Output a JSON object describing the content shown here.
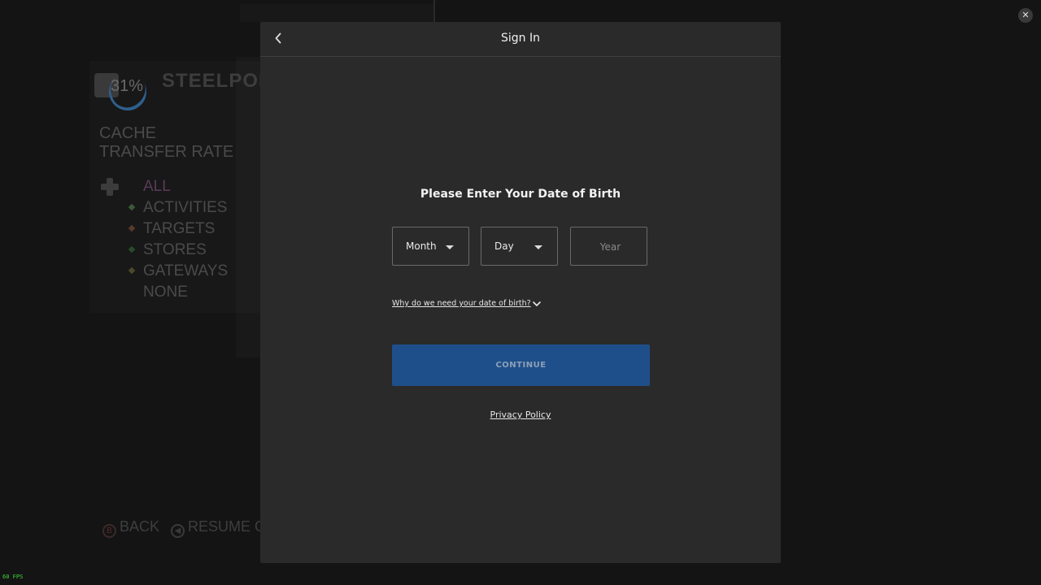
{
  "background_game": {
    "percent": "31%",
    "location_title": "STEELPORT",
    "category_line1": "CACHE",
    "category_line2": "TRANSFER RATE",
    "filters": [
      {
        "label": "ALL",
        "color": ""
      },
      {
        "label": "ACTIVITIES",
        "color": "#3a5a3a"
      },
      {
        "label": "TARGETS",
        "color": "#5a3a2a"
      },
      {
        "label": "STORES",
        "color": "#2a4a2a"
      },
      {
        "label": "GATEWAYS",
        "color": "#4a4a2a"
      },
      {
        "label": "NONE",
        "color": ""
      }
    ],
    "back_glyph": "B",
    "back_label": "BACK",
    "resume_glyph": "◀",
    "resume_label": "RESUME G",
    "fps": "60 FPS"
  },
  "overlay": {
    "close_glyph": "✕"
  },
  "modal": {
    "title": "Sign In",
    "heading": "Please Enter Your Date of Birth",
    "month_label": "Month",
    "day_label": "Day",
    "year_placeholder": "Year",
    "year_value": "",
    "why_link": "Why do we need your date of birth?",
    "continue_label": "CONTINUE",
    "privacy_link": "Privacy Policy"
  }
}
